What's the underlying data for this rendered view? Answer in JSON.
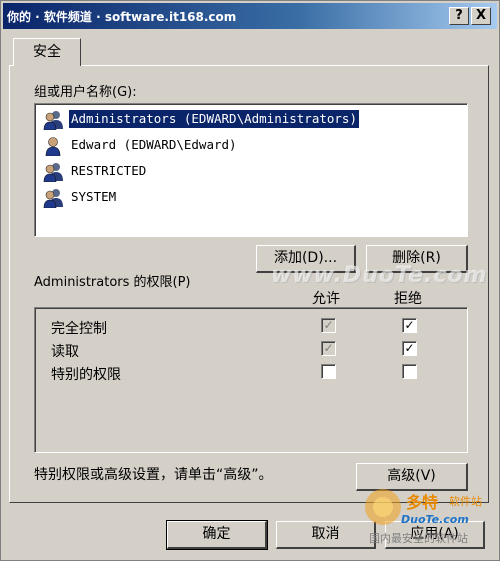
{
  "title_bar": {
    "title": "你的 · 软件频道 ·  software.it168.com",
    "help_label": "?",
    "close_label": "X"
  },
  "tabs": [
    {
      "label": "安全"
    }
  ],
  "groups": {
    "label": "组或用户名称(G):",
    "items": [
      {
        "text": "Administrators (EDWARD\\Administrators)",
        "selected": true,
        "icon": "users-group-icon"
      },
      {
        "text": "Edward (EDWARD\\Edward)",
        "selected": false,
        "icon": "user-icon"
      },
      {
        "text": "RESTRICTED",
        "selected": false,
        "icon": "users-group-icon"
      },
      {
        "text": "SYSTEM",
        "selected": false,
        "icon": "users-group-icon"
      }
    ],
    "add_label": "添加(D)...",
    "remove_label": "删除(R)"
  },
  "permissions": {
    "label": "Administrators 的权限(P)",
    "allow_header": "允许",
    "deny_header": "拒绝",
    "rows": [
      {
        "name": "完全控制",
        "allow": true,
        "allow_disabled": true,
        "deny": true
      },
      {
        "name": "读取",
        "allow": true,
        "allow_disabled": true,
        "deny": true
      },
      {
        "name": "特别的权限",
        "allow": false,
        "allow_disabled": false,
        "deny": false
      }
    ]
  },
  "advanced": {
    "hint": "特别权限或高级设置，请单击“高级”。",
    "button_label": "高级(V)"
  },
  "footer": {
    "ok_label": "确定",
    "cancel_label": "取消",
    "apply_label": "应用(A)"
  },
  "watermark": {
    "text": "www.DuoTe.com",
    "logo_name": "多特",
    "logo_sub": "软件站",
    "logo_url": "DuoTe.com",
    "logo_tag": "国内最安全的软件站"
  },
  "colors": {
    "face": "#d4d0c8",
    "selection": "#0a246a",
    "titlebar": "#0a246a"
  }
}
